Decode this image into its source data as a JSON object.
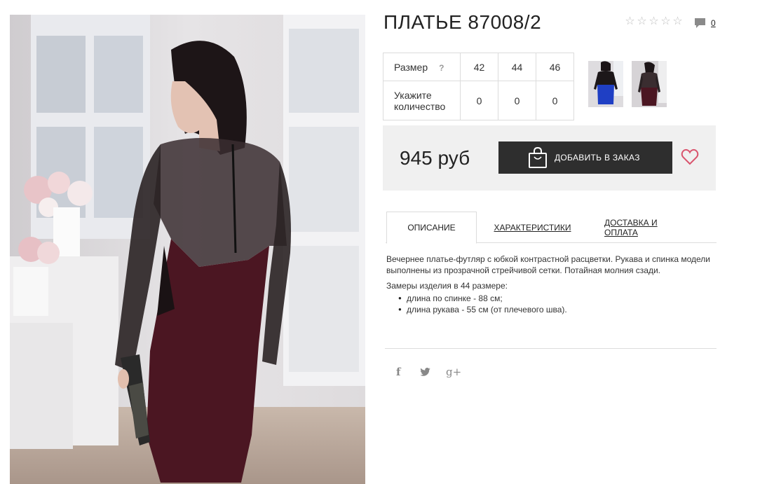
{
  "product": {
    "title": "ПЛАТЬЕ 87008/2",
    "rating_stars": 5,
    "rating_filled": 0,
    "comment_count": "0"
  },
  "size_table": {
    "size_label": "Размер",
    "help_mark": "?",
    "quantity_label": "Укажите количество",
    "sizes": [
      "42",
      "44",
      "46"
    ],
    "quantities": [
      "0",
      "0",
      "0"
    ]
  },
  "thumbnails": [
    {
      "icon": "dress-blue-skirt-front-thumbnail"
    },
    {
      "icon": "dress-burgundy-back-thumbnail"
    }
  ],
  "purchase": {
    "price": "945 руб",
    "add_button_label": "ДОБАВИТЬ В ЗАКАЗ",
    "wishlist_icon": "heart-icon",
    "heart_color": "#d9546d"
  },
  "tabs": [
    {
      "label": "ОПИСАНИЕ",
      "active": true
    },
    {
      "label": "ХАРАКТЕРИСТИКИ",
      "active": false
    },
    {
      "label": "ДОСТАВКА И ОПЛАТА",
      "active": false
    }
  ],
  "description": {
    "paragraph": "Вечернее платье-футляр с юбкой контрастной расцветки. Рукава и спинка модели выполнены из прозрачной стрейчивой сетки. Потайная молния сзади.",
    "measurements_title": "Замеры изделия в 44 размере:",
    "measurements": [
      "длина по спинке - 88 см;",
      "длина рукава - 55 см (от плечевого шва)."
    ]
  },
  "social": {
    "facebook": "f",
    "twitter": "t",
    "googleplus": "g+"
  }
}
